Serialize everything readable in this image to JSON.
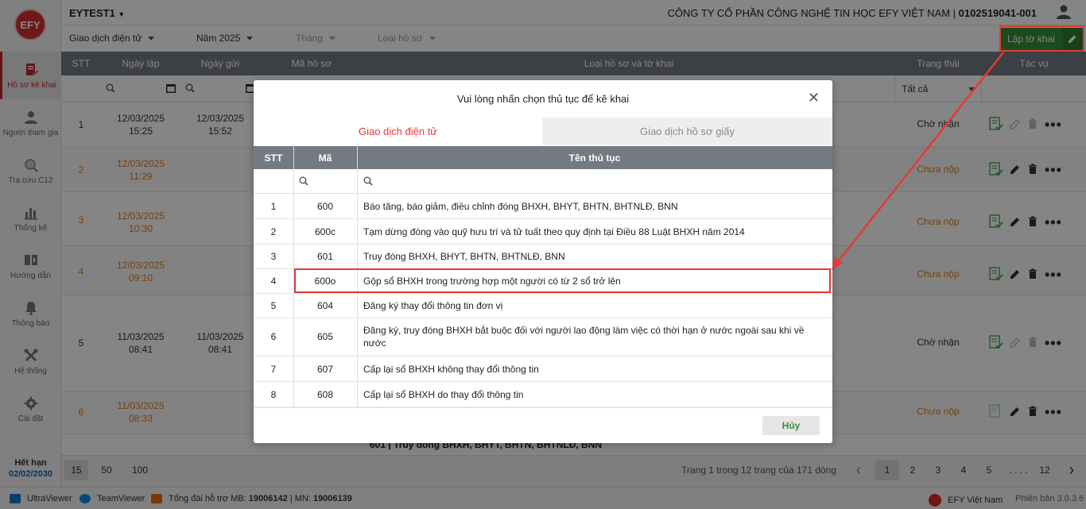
{
  "sidebar": {
    "logo": "EFY",
    "items": [
      {
        "label": "Hồ sơ kê khai",
        "icon": "edit-doc-icon"
      },
      {
        "label": "Người tham gia",
        "icon": "person-icon"
      },
      {
        "label": "Tra cứu C12",
        "icon": "search-icon"
      },
      {
        "label": "Thống kê",
        "icon": "bar-chart-icon"
      },
      {
        "label": "Hướng dẫn",
        "icon": "book-icon"
      },
      {
        "label": "Thông báo",
        "icon": "bell-icon"
      },
      {
        "label": "Hệ thống",
        "icon": "tools-icon"
      },
      {
        "label": "Cài đặt",
        "icon": "gear-icon"
      }
    ],
    "expire_label": "Hết hạn",
    "expire_date": "02/02/2030"
  },
  "topbar": {
    "org": "EYTEST1",
    "company": "CÔNG TY CỔ PHẦN CÔNG NGHỆ TIN HỌC EFY VIỆT NAM | ",
    "tax": "0102519041-001"
  },
  "filters": {
    "type": "Giao dịch điện tử",
    "year": "Năm 2025",
    "month": "Tháng",
    "doc_type": "Loại hồ sơ",
    "create_button": "Lập tờ khai"
  },
  "table": {
    "headers": [
      "STT",
      "Ngày lập",
      "Ngày gửi",
      "Mã hồ sơ",
      "Loại hồ sơ và tờ khai",
      "Trạng thái",
      "Tác vụ"
    ],
    "status_filter": "Tất cả",
    "rows": [
      {
        "stt": "1",
        "created_date": "12/03/2025",
        "created_time": "15:25",
        "sent_date": "12/03/2025",
        "sent_time": "15:52",
        "status": "Chờ nhận"
      },
      {
        "stt": "2",
        "created_date": "12/03/2025",
        "created_time": "11:29",
        "sent_date": "",
        "sent_time": "",
        "status": "Chưa nộp"
      },
      {
        "stt": "3",
        "created_date": "12/03/2025",
        "created_time": "10:30",
        "sent_date": "",
        "sent_time": "",
        "status": "Chưa nộp"
      },
      {
        "stt": "4",
        "created_date": "12/03/2025",
        "created_time": "09:10",
        "sent_date": "",
        "sent_time": "",
        "status": "Chưa nộp"
      },
      {
        "stt": "5",
        "created_date": "11/03/2025",
        "created_time": "08:41",
        "sent_date": "11/03/2025",
        "sent_time": "08:41",
        "status": "Chờ nhận"
      },
      {
        "stt": "6",
        "created_date": "11/03/2025",
        "created_time": "08:33",
        "sent_date": "",
        "sent_time": "",
        "status": "Chưa nộp"
      }
    ],
    "partial_text": "601 | Truy đóng BHXH, BHYT, BHTN, BHTNLĐ, BNN"
  },
  "pager": {
    "sizes": [
      "15",
      "50",
      "100"
    ],
    "info": "Trang 1 trong 12 trang của 171 dòng",
    "pages": [
      "1",
      "2",
      "3",
      "4",
      "5",
      ". . . .",
      "12"
    ]
  },
  "footer": {
    "ultraviewer": "UltraViewer",
    "teamviewer": "TeamViewer",
    "hotline_label": "Tổng đài hỗ trợ MB: ",
    "hotline_mb": "19006142",
    "hotline_sep": " | MN: ",
    "hotline_mn": "19006139",
    "brand": "EFY Việt Nam",
    "version": "Phiên bản 3.0.3.6"
  },
  "modal": {
    "title": "Vui lòng nhấn chọn thủ tục để kê khai",
    "tabs": [
      "Giao dịch điện tử",
      "Giao dịch hồ sơ giấy"
    ],
    "headers": [
      "STT",
      "Mã",
      "Tên thủ tục"
    ],
    "rows": [
      {
        "stt": "1",
        "code": "600",
        "name": "Báo tăng, báo giảm, điều chỉnh đóng BHXH, BHYT, BHTN, BHTNLĐ, BNN"
      },
      {
        "stt": "2",
        "code": "600c",
        "name": "Tạm dừng đóng vào quỹ hưu trí và tử tuất theo quy định tại Điều 88 Luật BHXH năm 2014"
      },
      {
        "stt": "3",
        "code": "601",
        "name": "Truy đóng BHXH, BHYT, BHTN, BHTNLĐ, BNN"
      },
      {
        "stt": "4",
        "code": "600o",
        "name": "Gộp sổ BHXH trong trường hợp một người có từ 2 sổ trở lên"
      },
      {
        "stt": "5",
        "code": "604",
        "name": "Đăng ký thay đổi thông tin đơn vị"
      },
      {
        "stt": "6",
        "code": "605",
        "name": "Đăng ký, truy đóng BHXH bắt buộc đối với người lao động làm việc có thời hạn ở nước ngoài sau khi về nước"
      },
      {
        "stt": "7",
        "code": "607",
        "name": "Cấp lại sổ BHXH không thay đổi thông tin"
      },
      {
        "stt": "8",
        "code": "608",
        "name": "Cấp lại sổ BHXH do thay đổi thông tin"
      }
    ],
    "cancel": "Hủy"
  },
  "colors": {
    "accent": "#c62828",
    "green": "#388e3c",
    "orange": "#e07b1f",
    "header": "#737a82",
    "highlight": "#e53935"
  }
}
